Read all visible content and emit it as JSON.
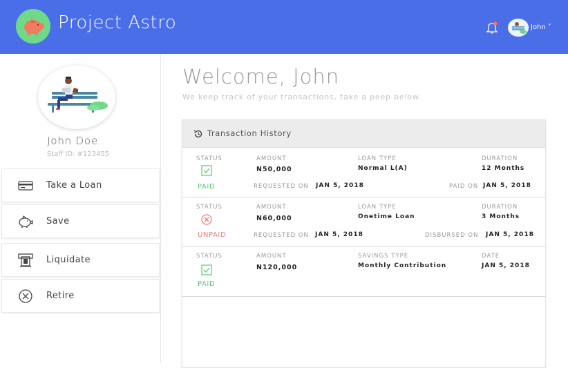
{
  "header": {
    "title": "Project Astro",
    "user_name": "John ˅",
    "brand_color": "#4a6ee8",
    "logo_icon": "piggy-bank-icon",
    "notification_icon": "bell-icon"
  },
  "sidebar": {
    "profile_name": "John Doe",
    "staff_id": "Staff ID: #123455",
    "items": [
      {
        "label": "Take a Loan",
        "icon": "credit-card-icon"
      },
      {
        "label": "Save",
        "icon": "piggy-bank-icon"
      },
      {
        "label": "Liquidate",
        "icon": "atm-icon"
      },
      {
        "label": "Retire",
        "icon": "close-circle-icon"
      }
    ]
  },
  "main": {
    "welcome": "Welcome, John",
    "subtitle": "We keep track of your transactions, take a peep below.",
    "history_title": "Transaction History",
    "transactions": [
      {
        "status_label": "STATUS",
        "status": "PAID",
        "amount_label": "AMOUNT",
        "amount": "N50,000",
        "type_label": "LOAN TYPE",
        "type": "Normal L(A)",
        "duration_label": "DURATION",
        "duration": "12 Months",
        "requested_label": "REQUESTED ON",
        "requested": "JAN 5, 2018",
        "end_label": "PAID ON",
        "end": "JAN 5, 2018"
      },
      {
        "status_label": "STATUS",
        "status": "UNPAID",
        "amount_label": "AMOUNT",
        "amount": "N60,000",
        "type_label": "LOAN TYPE",
        "type": "Onetime Loan",
        "duration_label": "DURATION",
        "duration": "3 Months",
        "requested_label": "REQUESTED ON",
        "requested": "JAN 5, 2018",
        "end_label": "DISBURSED ON",
        "end": "JAN 5, 2018"
      },
      {
        "status_label": "STATUS",
        "status": "PAID",
        "amount_label": "AMOUNT",
        "amount": "N120,000",
        "type_label": "SAVINGS TYPE",
        "type": "Monthly Contribution",
        "duration_label": "DATE",
        "duration": "JAN 5, 2018"
      }
    ]
  },
  "colors": {
    "paid": "#5bc77a",
    "unpaid": "#f07b7b"
  }
}
